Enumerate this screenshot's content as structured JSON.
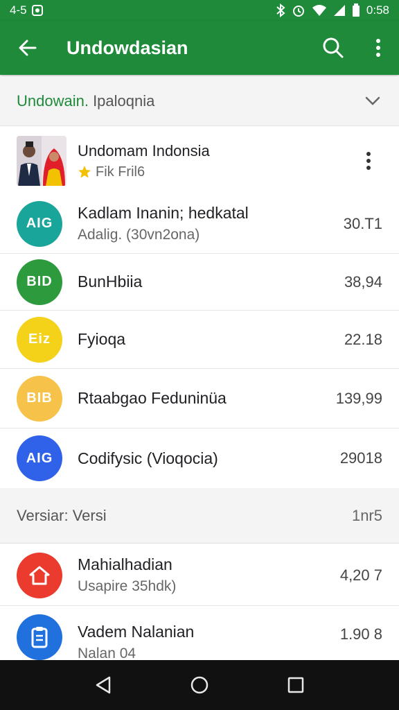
{
  "status_bar": {
    "left_text": "4-5",
    "time": "0:58"
  },
  "app_bar": {
    "title": "Undowdasian",
    "back_icon": "arrow-back-icon",
    "search_icon": "search-icon",
    "more_icon": "more-vert-icon"
  },
  "filter": {
    "label_accent": "Undowain.",
    "label_rest": " Ipaloqnia"
  },
  "featured": {
    "name": "Undomam Indonsia",
    "meta": "Fik Fril6",
    "accent_color": "#f2c200"
  },
  "items": [
    {
      "primary": "Kadlam Inanin; hedkatal",
      "secondary": "Adalig. (30vn2ona)",
      "value": "30.T1",
      "badge": "AIG",
      "color": "#1aa59a"
    },
    {
      "primary": "BunHbiia",
      "secondary": "",
      "value": "38,94",
      "badge": "BID",
      "color": "#2e9a3e"
    },
    {
      "primary": "Fyioqa",
      "secondary": "",
      "value": "22.18",
      "badge": "Eiz",
      "color": "#f4d21a"
    },
    {
      "primary": "Rtaabgao Feduninüa",
      "secondary": "",
      "value": "139,99",
      "badge": "BIB",
      "color": "#f6c24a"
    },
    {
      "primary": "Codifysic (Vioqocia)",
      "secondary": "",
      "value": "29018",
      "badge": "AIG",
      "color": "#2f62e8"
    }
  ],
  "section": {
    "label": "Versiar: Versi",
    "value": "1nr5"
  },
  "items2": [
    {
      "primary": "Mahialhadian",
      "secondary": "Usapire 35hdk)",
      "value": "4,20 7",
      "icon": "home-outline-icon",
      "color": "#ea3b2e"
    },
    {
      "primary": "Vadem Nalanian",
      "secondary": "Nalan 04",
      "value": "1.90 8",
      "icon": "clipboard-icon",
      "color": "#2070dd"
    }
  ],
  "nav_bar": {
    "back_icon": "nav-back-icon",
    "home_icon": "nav-home-icon",
    "recents_icon": "nav-recents-icon"
  }
}
